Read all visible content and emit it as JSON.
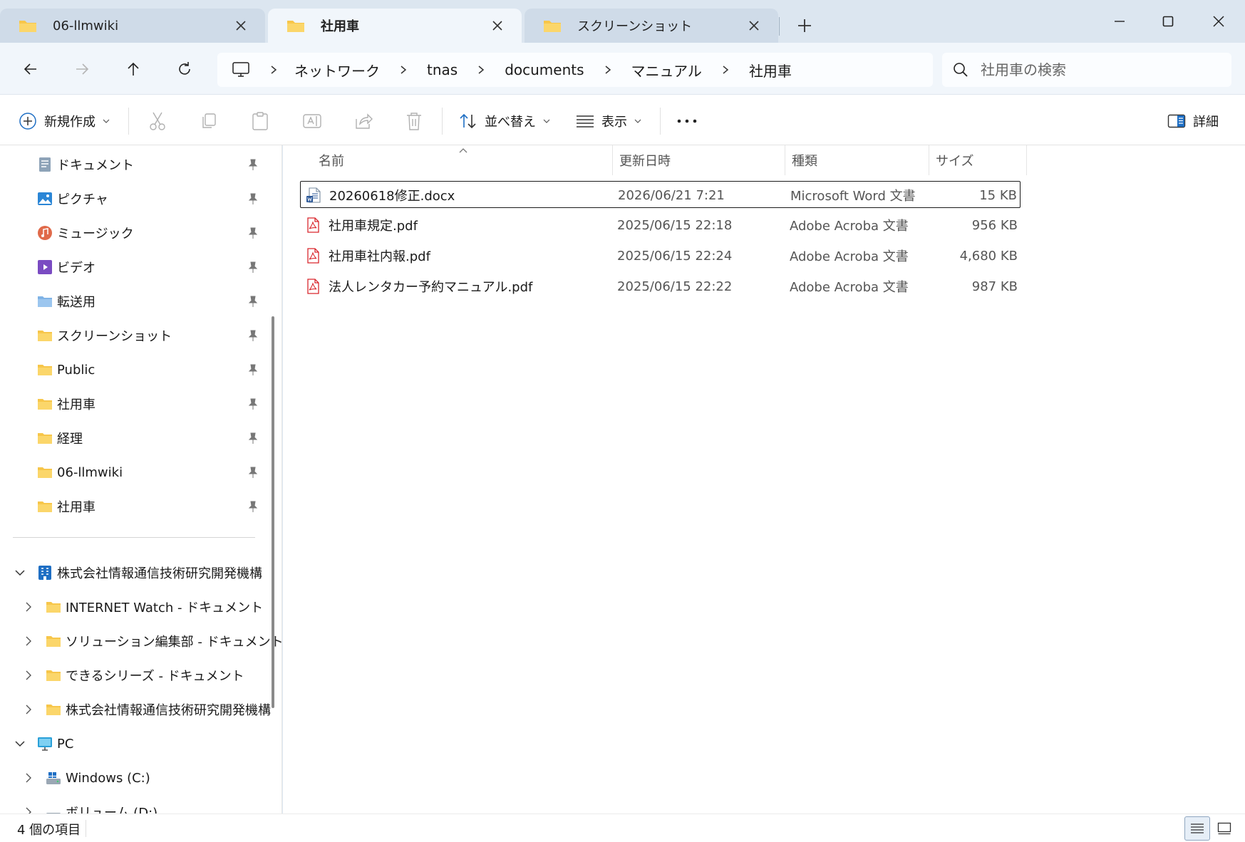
{
  "tabs": [
    {
      "label": "06-llmwiki"
    },
    {
      "label": "社用車"
    },
    {
      "label": "スクリーンショット"
    }
  ],
  "address": {
    "crumbs": [
      "ネットワーク",
      "tnas",
      "documents",
      "マニュアル",
      "社用車"
    ]
  },
  "search": {
    "placeholder": "社用車の検索"
  },
  "toolbar": {
    "new_label": "新規作成",
    "sort_label": "並べ替え",
    "view_label": "表示",
    "details_label": "詳細"
  },
  "nav": {
    "quick_access": [
      {
        "label": "ドキュメント",
        "icon": "documents-icon"
      },
      {
        "label": "ピクチャ",
        "icon": "pictures-icon"
      },
      {
        "label": "ミュージック",
        "icon": "music-icon"
      },
      {
        "label": "ビデオ",
        "icon": "videos-icon"
      },
      {
        "label": "転送用",
        "icon": "folder-icon"
      },
      {
        "label": "スクリーンショット",
        "icon": "folder-icon"
      },
      {
        "label": "Public",
        "icon": "folder-icon"
      },
      {
        "label": "社用車",
        "icon": "folder-icon"
      },
      {
        "label": "経理",
        "icon": "folder-icon"
      },
      {
        "label": "06-llmwiki",
        "icon": "folder-icon"
      },
      {
        "label": "社用車",
        "icon": "folder-icon"
      }
    ],
    "org": {
      "label": "株式会社情報通信技術研究開発機構",
      "children": [
        "INTERNET Watch - ドキュメント",
        "ソリューション編集部 - ドキュメント",
        "できるシリーズ - ドキュメント",
        "株式会社情報通信技術研究開発機構"
      ]
    },
    "pc": {
      "label": "PC",
      "children": [
        "Windows (C:)",
        "ボリューム (D:)"
      ]
    }
  },
  "files": {
    "headers": {
      "name": "名前",
      "date": "更新日時",
      "type": "種類",
      "size": "サイズ"
    },
    "rows": [
      {
        "name": "20260618修正.docx",
        "date": "2026/06/21 7:21",
        "type": "Microsoft Word 文書",
        "size": "15 KB",
        "icon": "word-doc-icon",
        "selected": true
      },
      {
        "name": "社用車規定.pdf",
        "date": "2025/06/15 22:18",
        "type": "Adobe Acroba 文書",
        "size": "956 KB",
        "icon": "pdf-icon",
        "selected": false
      },
      {
        "name": "社用車社内報.pdf",
        "date": "2025/06/15 22:24",
        "type": "Adobe Acroba 文書",
        "size": "4,680 KB",
        "icon": "pdf-icon",
        "selected": false
      },
      {
        "name": "法人レンタカー予約マニュアル.pdf",
        "date": "2025/06/15 22:22",
        "type": "Adobe Acroba 文書",
        "size": "987 KB",
        "icon": "pdf-icon",
        "selected": false
      }
    ]
  },
  "status": {
    "item_count": "4 個の項目"
  },
  "colors": {
    "folder": "#f7c64a",
    "pdf": "#d9262c",
    "word": "#2b5797",
    "accent": "#1f6fc4"
  }
}
